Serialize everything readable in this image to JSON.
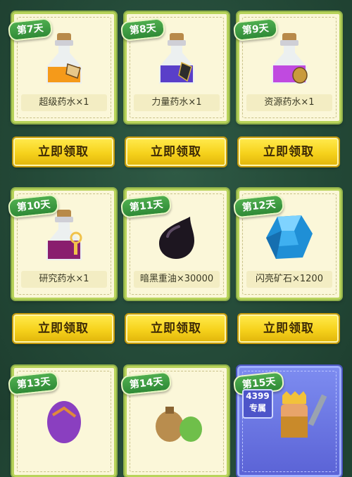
{
  "cards": [
    {
      "day": "第7天",
      "label": "超级药水×1",
      "icon": "super-potion-icon"
    },
    {
      "day": "第8天",
      "label": "力量药水×1",
      "icon": "power-potion-icon"
    },
    {
      "day": "第9天",
      "label": "资源药水×1",
      "icon": "resource-potion-icon"
    },
    {
      "day": "第10天",
      "label": "研究药水×1",
      "icon": "research-potion-icon"
    },
    {
      "day": "第11天",
      "label": "暗黑重油×30000",
      "icon": "dark-elixir-drop-icon"
    },
    {
      "day": "第12天",
      "label": "闪亮矿石×1200",
      "icon": "shiny-ore-gem-icon"
    },
    {
      "day": "第13天",
      "label": "",
      "icon": "purple-egg-icon"
    },
    {
      "day": "第14天",
      "label": "",
      "icon": "loot-sack-icon"
    },
    {
      "day": "第15天",
      "label": "",
      "icon": "barbarian-king-icon",
      "badge": "4399专属"
    }
  ],
  "vip_badge_line1": "4399",
  "vip_badge_line2": "专属",
  "claim_label": "立即领取",
  "colors": {
    "background": "#244a38",
    "card": "#fbf7d9",
    "button": "#f6d21c",
    "day_tag": "#2f8a37"
  }
}
